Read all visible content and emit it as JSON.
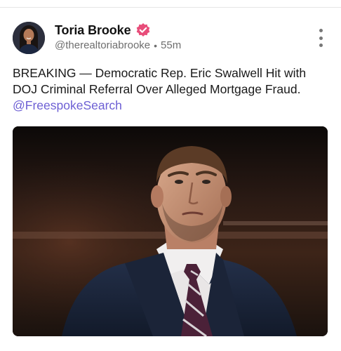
{
  "post": {
    "author": {
      "display_name": "Toria Brooke",
      "handle": "@therealtoriabrooke",
      "time_ago": "55m",
      "verified_badge_color": "#e84d7a"
    },
    "text_main": "BREAKING — Democratic Rep. Eric Swalwell Hit with DOJ Criminal Referral Over Alleged Mortgage Fraud.",
    "mention": "@FreespokeSearch",
    "mention_color": "#6d5fd4",
    "image": {
      "alt": "Man in a navy suit and striped tie looking upward"
    },
    "more_icon": "vertical-ellipsis-icon"
  }
}
